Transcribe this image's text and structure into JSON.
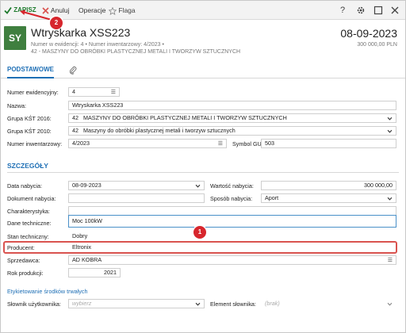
{
  "toolbar": {
    "save_label": "ZAPISZ",
    "cancel_label": "Anuluj",
    "operations_label": "Operacje",
    "flag_label": "Flaga",
    "help_label": "?"
  },
  "header": {
    "avatar": "SY",
    "title": "Wtryskarka XSS223",
    "line1_part1": "Numer w ewidencji: 4",
    "line1_sep": "•",
    "line1_part2": "Numer inwentarzowy: 4/2023",
    "line1_dot": "•",
    "line2": "42 - MASZYNY DO OBRÓBKI PLASTYCZNEJ METALI I TWORZYW SZTUCZNYCH",
    "date": "08-09-2023",
    "amount": "300 000,00 PLN"
  },
  "tabs": {
    "basic": "PODSTAWOWE",
    "attachments_icon": "paperclip-icon"
  },
  "basic": {
    "numer_ewidencyjny": {
      "label": "Numer ewidencyjny:",
      "value": "4"
    },
    "nazwa": {
      "label": "Nazwa:",
      "value": "Wtryskarka XSS223"
    },
    "grupa2016": {
      "label": "Grupa KŚT 2016:",
      "code": "42",
      "value": "MASZYNY DO OBRÓBKI PLASTYCZNEJ METALI I TWORZYW SZTUCZNYCH"
    },
    "grupa2010": {
      "label": "Grupa KŚT 2010:",
      "code": "42",
      "value": "Maszyny do obróbki plastycznej metali i tworzyw sztucznych"
    },
    "numer_inw": {
      "label": "Numer inwentarzowy:",
      "value": "4/2023"
    },
    "symbol_gus": {
      "label": "Symbol GUS:",
      "value": "503"
    }
  },
  "details": {
    "title": "SZCZEGÓŁY",
    "data_nabycia": {
      "label": "Data nabycia:",
      "value": "08-09-2023"
    },
    "wartosc_nabycia": {
      "label": "Wartość nabycia:",
      "value": "300 000,00"
    },
    "dokument_nabycia": {
      "label": "Dokument nabycia:",
      "value": ""
    },
    "sposob_nabycia": {
      "label": "Sposób nabycia:",
      "value": "Aport"
    },
    "charakterystyka": {
      "label": "Charakterystyka:",
      "value": ""
    },
    "dane_techniczne": {
      "label": "Dane techniczne:",
      "value": "Moc 100kW"
    },
    "stan_techniczny": {
      "label": "Stan techniczny:",
      "value": "Dobry"
    },
    "producent": {
      "label": "Producent:",
      "value": "Eltronix"
    },
    "sprzedawca": {
      "label": "Sprzedawca:",
      "value": "AD KOBRA"
    },
    "rok_produkcji": {
      "label": "Rok produkcji:",
      "value": "2021"
    }
  },
  "labels_section": {
    "title": "Etykietowanie środków trwałych",
    "slownik": {
      "label": "Słownik użytkownika:",
      "placeholder": "wybierz"
    },
    "element": {
      "label": "Element słownika:",
      "placeholder": "(brak)"
    }
  },
  "annotations": {
    "badge1": "1",
    "badge2": "2"
  },
  "colors": {
    "accent": "#1e6fb5",
    "avatar": "#3f7f3f",
    "highlight": "#d9534f",
    "badge": "#d7262d",
    "save": "#1d7a2c"
  }
}
